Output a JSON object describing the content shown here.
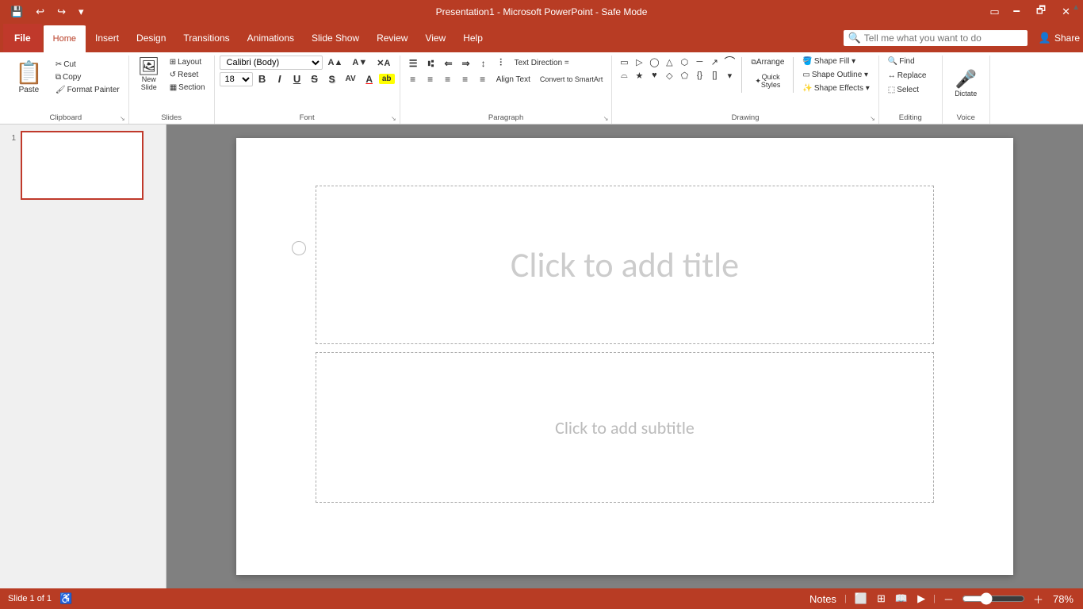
{
  "titlebar": {
    "title": "Presentation1  -  Microsoft PowerPoint  -  Safe Mode",
    "quicksave": "💾",
    "undo": "↩",
    "redo": "↪",
    "customize": "▾",
    "minimize": "🗕",
    "restore": "🗗",
    "close": "✕"
  },
  "menu": {
    "file": "File",
    "tabs": [
      "Home",
      "Insert",
      "Design",
      "Transitions",
      "Animations",
      "Slide Show",
      "Review",
      "View",
      "Help"
    ],
    "active_tab": "Home",
    "search_placeholder": "Tell me what you want to do",
    "share": "Share"
  },
  "ribbon": {
    "clipboard": {
      "label": "Clipboard",
      "paste": "Paste",
      "cut": "✂",
      "cut_label": "Cut",
      "copy": "⧉",
      "copy_label": "Copy",
      "format_painter": "🖌",
      "format_painter_label": "Format Painter",
      "dialog_icon": "⌄"
    },
    "slides": {
      "label": "Slides",
      "new_slide": "New\nSlide",
      "layout": "Layout",
      "reset": "Reset",
      "section": "Section",
      "dialog_icon": "⌄"
    },
    "font": {
      "label": "Font",
      "font_name": "Calibri (Body)",
      "font_size": "18",
      "increase_size": "A▲",
      "decrease_size": "A▼",
      "clear_format": "✕A",
      "bold": "B",
      "italic": "I",
      "underline": "U",
      "strikethrough": "S",
      "shadow": "S",
      "char_spacing": "AV",
      "font_color": "A",
      "highlight": "ab",
      "dialog_icon": "⌄"
    },
    "paragraph": {
      "label": "Paragraph",
      "bullets": "☰",
      "numbering": "⑆",
      "indent_less": "⇐",
      "indent_more": "⇒",
      "line_spacing": "↕",
      "columns": "⫶",
      "align_left": "≡",
      "align_center": "≡",
      "align_right": "≡",
      "justify": "≡",
      "align_extra": "≡",
      "text_direction": "Text Direction =",
      "align_text": "Align Text",
      "smartart": "Convert to SmartArt",
      "dialog_icon": "⌄"
    },
    "drawing": {
      "label": "Drawing",
      "shapes": [
        "▭",
        "▷",
        "◯",
        "△",
        "⬡",
        "─",
        "↗",
        "⌒",
        "⌓",
        "⌔",
        "⌕",
        "⌖",
        "⌗",
        "⌘",
        "⌙",
        "⌚"
      ],
      "arrange": "Arrange",
      "quick_styles": "Quick\nStyles",
      "shape_fill": "Shape Fill ▾",
      "shape_outline": "Shape Outline ▾",
      "shape_effects": "Shape Effects ▾",
      "dialog_icon": "⌄"
    },
    "editing": {
      "label": "Editing",
      "find": "Find",
      "replace": "Replace",
      "select": "Select"
    },
    "voice": {
      "label": "Voice",
      "dictate": "Dictate"
    }
  },
  "slide_panel": {
    "slide_number": "1"
  },
  "slide": {
    "title_placeholder": "Click to add title",
    "subtitle_placeholder": "Click to add subtitle"
  },
  "statusbar": {
    "slide_info": "Slide 1 of 1",
    "notes": "Notes",
    "zoom": "78%",
    "zoom_value": 78
  }
}
